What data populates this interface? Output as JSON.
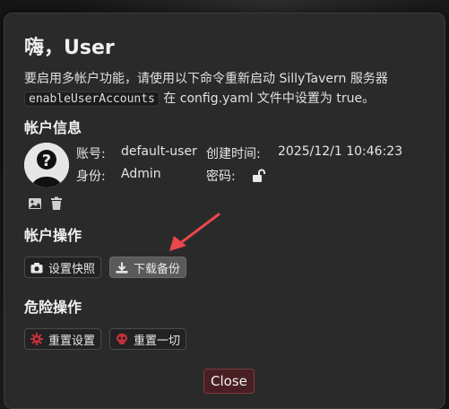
{
  "dialog": {
    "greeting": "嗨，User",
    "notice_before": "要启用多帐户功能，请使用以下命令重新启动 SillyTavern 服务器",
    "notice_code": "enableUserAccounts",
    "notice_after": " 在 config.yaml 文件中设置为 true。",
    "close_label": "Close"
  },
  "account_info": {
    "heading": "帐户信息",
    "username_label": "账号:",
    "username_value": "default-user",
    "created_label": "创建时间:",
    "created_value": "2025/12/1 10:46:23",
    "role_label": "身份:",
    "role_value": "Admin",
    "password_label": "密码:"
  },
  "account_actions": {
    "heading": "帐户操作",
    "snapshot_label": "设置快照",
    "download_label": "下载备份"
  },
  "danger_zone": {
    "heading": "危险操作",
    "reset_settings_label": "重置设置",
    "reset_all_label": "重置一切"
  },
  "icons": {
    "avatar": "silhouette-avatar",
    "image": "image-icon",
    "trash": "trash-icon",
    "lock": "unlock-icon",
    "camera": "camera-icon",
    "download": "download-icon",
    "gear": "gear-icon",
    "skull": "skull-icon",
    "arrow": "red-pointer-arrow"
  },
  "colors": {
    "dialog_bg": "#2a2a2a",
    "danger_icon": "#c0303a",
    "close_bg": "#4a1f24",
    "arrow": "#e8474c"
  }
}
